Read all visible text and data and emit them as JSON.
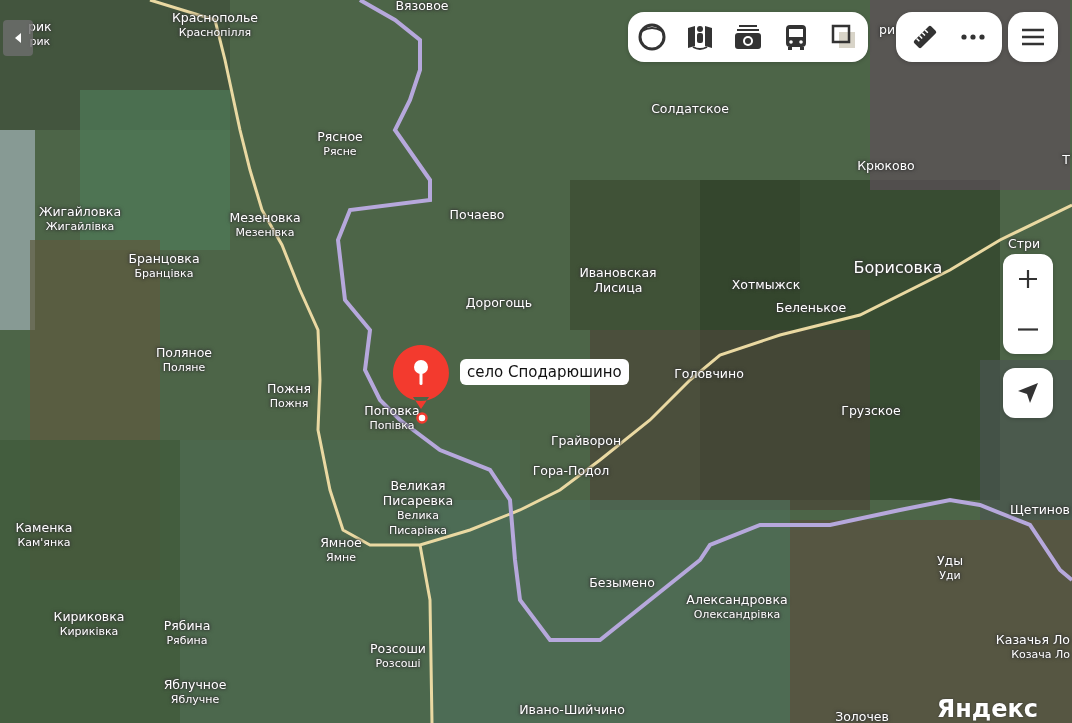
{
  "places": [
    {
      "name": "Вязовое"
    },
    {
      "name": "Краснополье",
      "alt": "Краснопілля"
    },
    {
      "name": "рик",
      "alt": "рик"
    },
    {
      "name": "ри"
    },
    {
      "name": "Солдатское"
    },
    {
      "name": "Рясное",
      "alt": "Рясне"
    },
    {
      "name": "Т"
    },
    {
      "name": "Крюково"
    },
    {
      "name": "Жигайловка",
      "alt": "Жигайлівка"
    },
    {
      "name": "Мезеновка",
      "alt": "Мезенівка"
    },
    {
      "name": "Почаево"
    },
    {
      "name": "Стри"
    },
    {
      "name": "Бранцовка",
      "alt": "Бранцівка"
    },
    {
      "name": "Борисовка",
      "kind": "town"
    },
    {
      "name": "Ивановская Лисица"
    },
    {
      "name": "Хотмыжск"
    },
    {
      "name": "Дорогощь"
    },
    {
      "name": "Беленькое"
    },
    {
      "name": "Поляное",
      "alt": "Поляне"
    },
    {
      "name": "Головчино"
    },
    {
      "name": "Пожня",
      "alt": "Пожня"
    },
    {
      "name": "Поповка",
      "alt": "Попівка"
    },
    {
      "name": "Грузское"
    },
    {
      "name": "Грайворон"
    },
    {
      "name": "Гора-Подол"
    },
    {
      "name": "Великая Писаревка",
      "alt": "Велика Писарівка"
    },
    {
      "name": "Щетинов"
    },
    {
      "name": "Каменка",
      "alt": "Кам'янка"
    },
    {
      "name": "Ямное",
      "alt": "Ямне"
    },
    {
      "name": "Уды",
      "alt": "Уди"
    },
    {
      "name": "Безымено"
    },
    {
      "name": "Александровка",
      "alt": "Олександрівка"
    },
    {
      "name": "Кириковка",
      "alt": "Кириківка"
    },
    {
      "name": "Рябина",
      "alt": "Рябина"
    },
    {
      "name": "Казачья Ло",
      "alt": "Козача Ло"
    },
    {
      "name": "Розсоши",
      "alt": "Розсоші"
    },
    {
      "name": "Яблучное",
      "alt": "Яблучне"
    },
    {
      "name": "Ивано-Шийчино"
    },
    {
      "name": "Золочев"
    }
  ],
  "marker": {
    "label": "село Сподарюшино"
  },
  "logo": "Яндекс"
}
